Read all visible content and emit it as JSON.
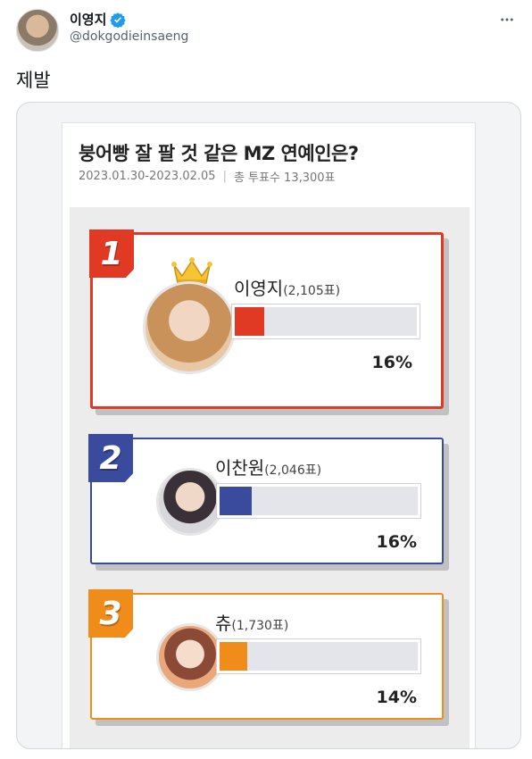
{
  "tweet": {
    "display_name": "이영지",
    "handle": "@dokgodieinsaeng",
    "text": "제발",
    "more_icon": "more-horizontal-icon",
    "verified_icon": "verified-badge-icon"
  },
  "poll": {
    "title": "붕어빵 잘 팔 것 같은 MZ 연예인은?",
    "date_range": "2023.01.30-2023.02.05",
    "total_label": "총 투표수 13,300표",
    "candidates": [
      {
        "rank": "1",
        "name": "이영지",
        "votes": "(2,105표)",
        "percent_label": "16%",
        "percent": 16,
        "color": "#e03a24",
        "crown_icon": "crown-icon"
      },
      {
        "rank": "2",
        "name": "이찬원",
        "votes": "(2,046표)",
        "percent_label": "16%",
        "percent": 16,
        "color": "#3a4a9c"
      },
      {
        "rank": "3",
        "name": "츄",
        "votes": "(1,730표)",
        "percent_label": "14%",
        "percent": 14,
        "color": "#f08c1a"
      }
    ]
  }
}
